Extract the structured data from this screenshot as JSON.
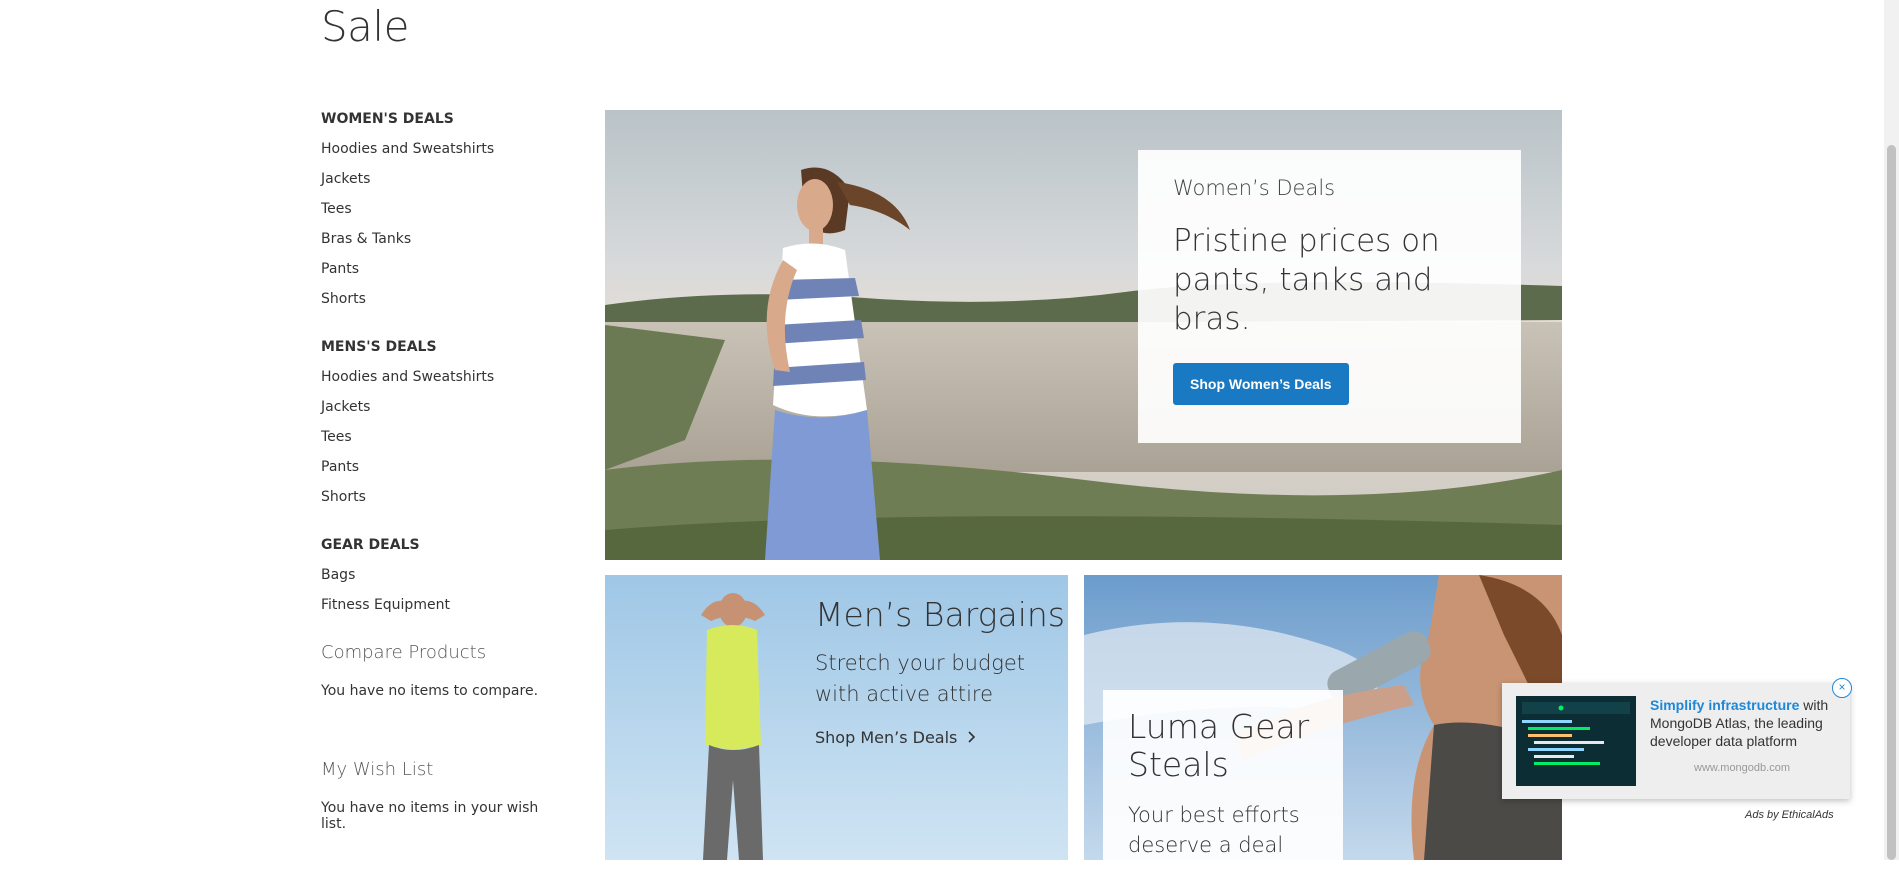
{
  "page": {
    "title": "Sale"
  },
  "sidebar": {
    "groups": [
      {
        "title": "WOMEN'S DEALS",
        "items": [
          "Hoodies and Sweatshirts",
          "Jackets",
          "Tees",
          "Bras & Tanks",
          "Pants",
          "Shorts"
        ]
      },
      {
        "title": "MENS'S DEALS",
        "items": [
          "Hoodies and Sweatshirts",
          "Jackets",
          "Tees",
          "Pants",
          "Shorts"
        ]
      },
      {
        "title": "GEAR DEALS",
        "items": [
          "Bags",
          "Fitness Equipment"
        ]
      }
    ],
    "compare": {
      "title": "Compare Products",
      "text": "You have no items to compare."
    },
    "wishlist": {
      "title": "My Wish List",
      "text": "You have no items in your wish list."
    }
  },
  "hero": {
    "kicker": "Women’s Deals",
    "headline": "Pristine prices on pants, tanks and bras.",
    "button": "Shop Women’s Deals"
  },
  "men_tile": {
    "title": "Men’s Bargains",
    "subtitle": "Stretch your budget with active attire",
    "link": "Shop Men’s Deals"
  },
  "gear_tile": {
    "title": "Luma Gear Steals",
    "subtitle": "Your best efforts deserve a deal"
  },
  "ad": {
    "highlight": "Simplify infrastructure",
    "text": " with MongoDB Atlas, the leading developer data platform",
    "domain": "www.mongodb.com",
    "attribution": "Ads by EthicalAds",
    "close": "×"
  },
  "colors": {
    "primary": "#1979c3",
    "ad_link": "#1e88d8"
  }
}
